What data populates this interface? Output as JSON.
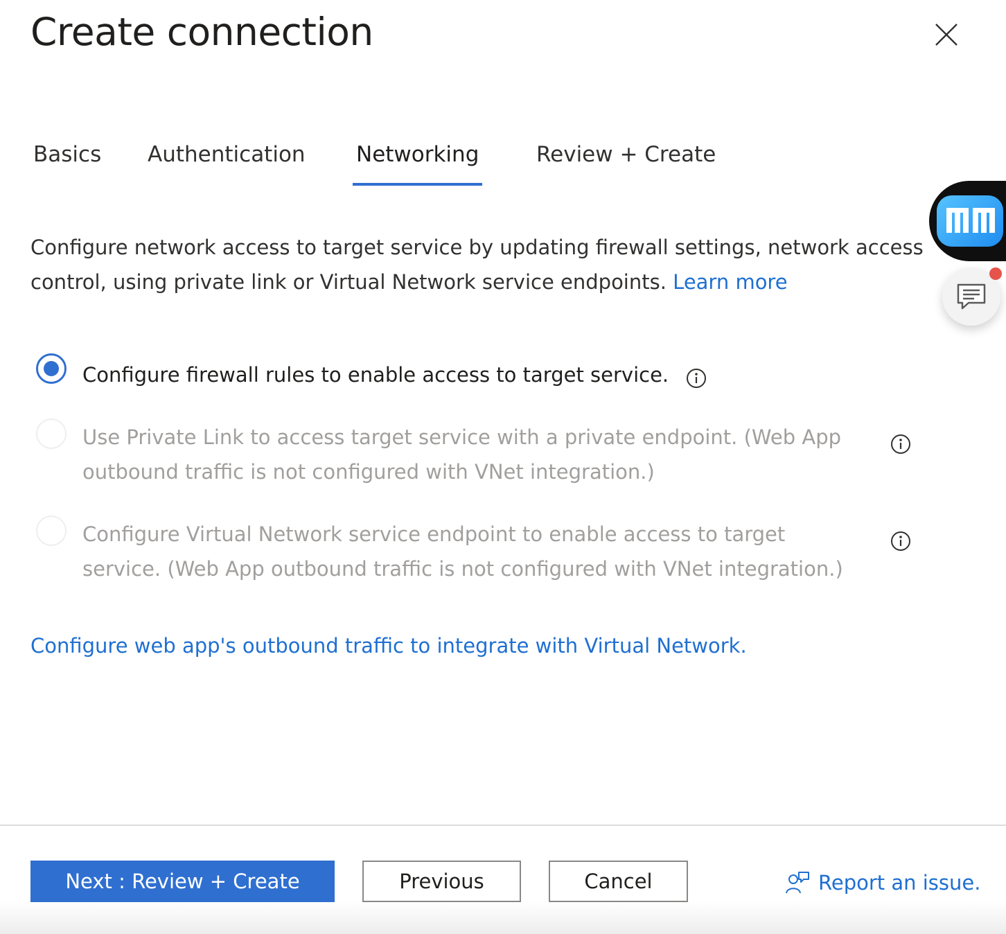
{
  "dialog": {
    "title": "Create connection"
  },
  "tabs": [
    {
      "label": "Basics",
      "active": false
    },
    {
      "label": "Authentication",
      "active": false
    },
    {
      "label": "Networking",
      "active": true
    },
    {
      "label": "Review + Create",
      "active": false
    }
  ],
  "description": {
    "text": "Configure network access to target service by updating firewall settings, network access control, using private link or Virtual Network service endpoints.",
    "link": "Learn more"
  },
  "options": [
    {
      "line1": "Configure firewall rules to enable access to target service.",
      "line2": "",
      "selected": true,
      "disabled": false
    },
    {
      "line1": "Use Private Link to access target service with a private endpoint. (Web App",
      "line2": "outbound traffic is not configured with VNet integration.)",
      "selected": false,
      "disabled": true
    },
    {
      "line1": "Configure Virtual Network service endpoint to enable access to target",
      "line2": "service. (Web App outbound traffic is not configured with VNet integration.)",
      "selected": false,
      "disabled": true
    }
  ],
  "vnet_link": "Configure web app's outbound traffic to integrate with Virtual Network.",
  "footer": {
    "next": "Next : Review + Create",
    "previous": "Previous",
    "cancel": "Cancel",
    "report": "Report an issue."
  },
  "colors": {
    "accent": "#2f6fd0",
    "link": "#1e6fd1",
    "disabled_text": "#a19f9d"
  },
  "icons": {
    "close": "close-icon",
    "info": "info-icon",
    "report": "person-feedback-icon",
    "feedback": "chat-bubble-icon",
    "extension": "app-logo-icon"
  }
}
